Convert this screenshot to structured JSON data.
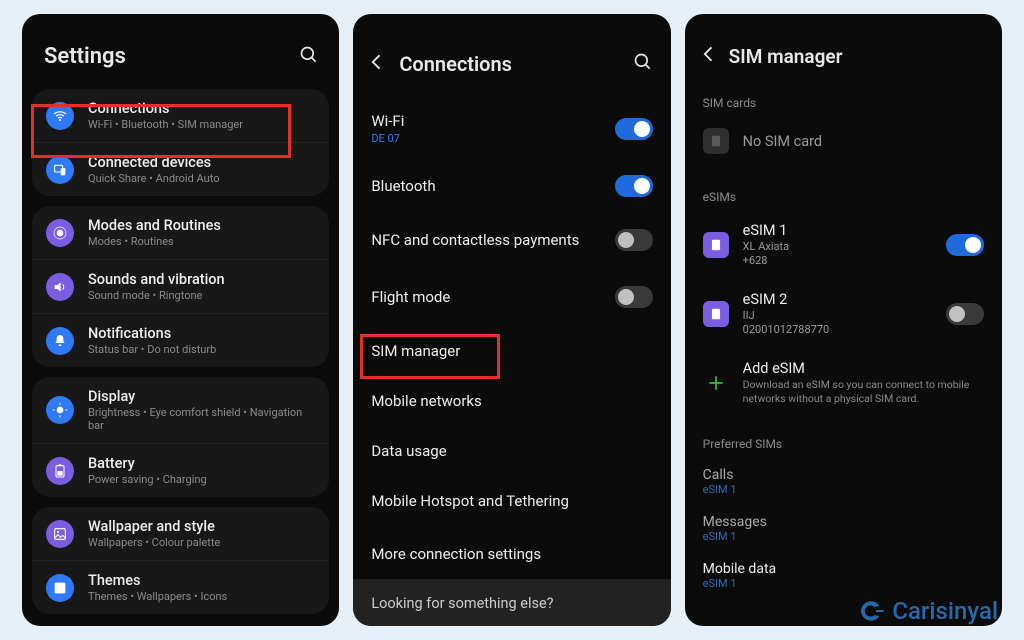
{
  "screen1": {
    "title": "Settings",
    "groups": [
      [
        {
          "title": "Connections",
          "sub": "Wi-Fi  •  Bluetooth  •  SIM manager",
          "color": "blue",
          "icon": "wifi"
        },
        {
          "title": "Connected devices",
          "sub": "Quick Share  •  Android Auto",
          "color": "blue",
          "icon": "devices"
        }
      ],
      [
        {
          "title": "Modes and Routines",
          "sub": "Modes  •  Routines",
          "color": "purple",
          "icon": "routines"
        },
        {
          "title": "Sounds and vibration",
          "sub": "Sound mode  •  Ringtone",
          "color": "purple",
          "icon": "sound"
        },
        {
          "title": "Notifications",
          "sub": "Status bar  •  Do not disturb",
          "color": "blue",
          "icon": "bell"
        }
      ],
      [
        {
          "title": "Display",
          "sub": "Brightness  •  Eye comfort shield  •  Navigation bar",
          "color": "blue",
          "icon": "display"
        },
        {
          "title": "Battery",
          "sub": "Power saving  •  Charging",
          "color": "purple",
          "icon": "battery"
        }
      ],
      [
        {
          "title": "Wallpaper and style",
          "sub": "Wallpapers  •  Colour palette",
          "color": "purple",
          "icon": "wallpaper"
        },
        {
          "title": "Themes",
          "sub": "Themes  •  Wallpapers  •  Icons",
          "color": "blue",
          "icon": "themes"
        }
      ]
    ]
  },
  "screen2": {
    "title": "Connections",
    "rows": [
      {
        "title": "Wi-Fi",
        "sub": "DE 07",
        "toggle": "on"
      },
      {
        "title": "Bluetooth",
        "sub": "",
        "toggle": "on"
      },
      {
        "title": "NFC and contactless payments",
        "sub": "",
        "toggle": "off"
      }
    ],
    "rows2": [
      {
        "title": "Flight mode",
        "toggle": "off"
      }
    ],
    "rows3": [
      {
        "title": "SIM manager"
      },
      {
        "title": "Mobile networks"
      },
      {
        "title": "Data usage"
      },
      {
        "title": "Mobile Hotspot and Tethering"
      }
    ],
    "rows4": [
      {
        "title": "More connection settings"
      }
    ],
    "footer": "Looking for something else?"
  },
  "screen3": {
    "title": "SIM manager",
    "sec_cards": "SIM cards",
    "no_sim": "No SIM card",
    "sec_esims": "eSIMs",
    "esims": [
      {
        "name": "eSIM 1",
        "carrier": "XL Axiata",
        "number": "+628",
        "toggle": "on"
      },
      {
        "name": "eSIM 2",
        "carrier": "IIJ",
        "number": "02001012788770",
        "toggle": "off"
      }
    ],
    "add": {
      "title": "Add eSIM",
      "sub": "Download an eSIM so you can connect to mobile networks without a physical SIM card."
    },
    "sec_pref": "Preferred SIMs",
    "prefs": [
      {
        "label": "Calls",
        "value": "eSIM 1",
        "active": false
      },
      {
        "label": "Messages",
        "value": "eSIM 1",
        "active": false
      },
      {
        "label": "Mobile data",
        "value": "eSIM 1",
        "active": true
      }
    ]
  },
  "watermark": "Carisinyal"
}
